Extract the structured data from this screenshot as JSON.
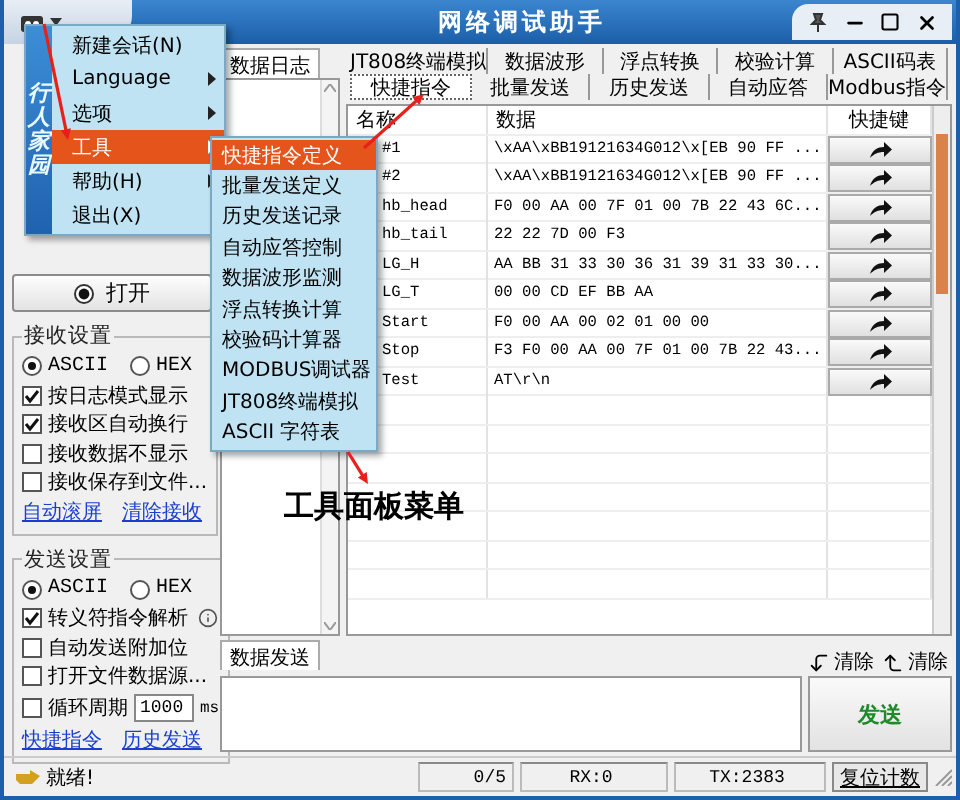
{
  "title_bar": {
    "title": "网络调试助手"
  },
  "main_menu": {
    "brand": "行人家园",
    "items": [
      {
        "label": "新建会话(N)",
        "submenu": false,
        "selected": false
      },
      {
        "label": "Language",
        "submenu": true,
        "selected": false
      },
      {
        "label": "选项",
        "submenu": true,
        "selected": false
      },
      {
        "label": "工具",
        "submenu": true,
        "selected": true
      },
      {
        "label": "帮助(H)",
        "submenu": true,
        "selected": false
      },
      {
        "label": "退出(X)",
        "submenu": false,
        "selected": false
      }
    ]
  },
  "tools_submenu": {
    "items": [
      {
        "label": "快捷指令定义",
        "selected": true
      },
      {
        "label": "批量发送定义",
        "selected": false
      },
      {
        "label": "历史发送记录",
        "selected": false
      },
      {
        "label": "自动应答控制",
        "selected": false
      },
      {
        "label": "数据波形监测",
        "selected": false
      },
      {
        "label": "浮点转换计算",
        "selected": false
      },
      {
        "label": "校验码计算器",
        "selected": false
      },
      {
        "label": "MODBUS调试器",
        "selected": false
      },
      {
        "label": "JT808终端模拟",
        "selected": false
      },
      {
        "label": "ASCII 字符表",
        "selected": false
      }
    ]
  },
  "connection": {
    "open_button": "打开"
  },
  "receive_settings": {
    "title": "接收设置",
    "modes": [
      {
        "label": "ASCII",
        "selected": true
      },
      {
        "label": "HEX",
        "selected": false
      }
    ],
    "options": [
      {
        "label": "按日志模式显示",
        "checked": true
      },
      {
        "label": "接收区自动换行",
        "checked": true
      },
      {
        "label": "接收数据不显示",
        "checked": false
      },
      {
        "label": "接收保存到文件...",
        "checked": false
      }
    ],
    "links": [
      "自动滚屏",
      "清除接收"
    ]
  },
  "send_settings": {
    "title": "发送设置",
    "modes": [
      {
        "label": "ASCII",
        "selected": true
      },
      {
        "label": "HEX",
        "selected": false
      }
    ],
    "options": [
      {
        "label": "转义符指令解析",
        "checked": true,
        "info": true
      },
      {
        "label": "自动发送附加位",
        "checked": false,
        "info": false
      },
      {
        "label": "打开文件数据源...",
        "checked": false,
        "info": false
      }
    ],
    "period": {
      "label": "循环周期",
      "checked": false,
      "value": "1000",
      "unit": "ms"
    },
    "links": [
      "快捷指令",
      "历史发送"
    ]
  },
  "data_log": {
    "tab": "数据日志"
  },
  "tabs_row_1": [
    {
      "label": "JT808终端模拟"
    },
    {
      "label": "数据波形"
    },
    {
      "label": "浮点转换"
    },
    {
      "label": "校验计算"
    },
    {
      "label": "ASCII码表"
    }
  ],
  "tabs_row_2": [
    {
      "label": "快捷指令",
      "selected": true
    },
    {
      "label": "批量发送",
      "selected": false
    },
    {
      "label": "历史发送",
      "selected": false
    },
    {
      "label": "自动应答",
      "selected": false
    },
    {
      "label": "Modbus指令",
      "selected": false
    }
  ],
  "table": {
    "columns": [
      "名称",
      "数据",
      "快捷键"
    ],
    "rows": [
      {
        "name": "#1",
        "data": "\\xAA\\xBB19121634G012\\x[EB 90 FF ..."
      },
      {
        "name": "#2",
        "data": "\\xAA\\xBB19121634G012\\x[EB 90 FF ..."
      },
      {
        "name": "hb_head",
        "data": "F0 00 AA 00 7F 01 00 7B 22 43 6C..."
      },
      {
        "name": "hb_tail",
        "data": "22 22 7D 00 F3"
      },
      {
        "name": "LG_H",
        "data": "AA BB 31 33 30 36 31 39 31 33 30..."
      },
      {
        "name": "LG_T",
        "data": "00 00 CD EF BB AA"
      },
      {
        "name": "Start",
        "data": "F0 00 AA 00 02 01 00 00"
      },
      {
        "name": "Stop",
        "data": "F3 F0 00 AA 00 7F 01 00 7B 22 43..."
      },
      {
        "name": "Test",
        "data": "AT\\r\\n"
      }
    ]
  },
  "send_area": {
    "tab": "数据发送",
    "clear_buttons": [
      "清除",
      "清除"
    ],
    "send_button": "发送"
  },
  "status_bar": {
    "message": "就绪!",
    "count": "0/5",
    "rx": "RX:0",
    "tx": "TX:2383",
    "reset_button": "复位计数"
  },
  "annotation": {
    "label": "工具面板菜单"
  }
}
